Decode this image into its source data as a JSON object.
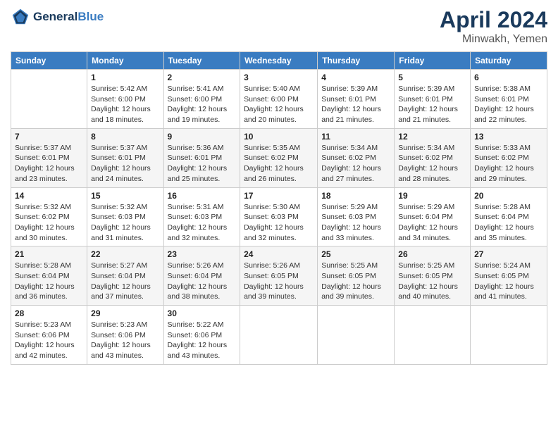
{
  "header": {
    "logo_line1": "General",
    "logo_line2": "Blue",
    "month_title": "April 2024",
    "location": "Minwakh, Yemen"
  },
  "weekdays": [
    "Sunday",
    "Monday",
    "Tuesday",
    "Wednesday",
    "Thursday",
    "Friday",
    "Saturday"
  ],
  "weeks": [
    [
      {
        "day": "",
        "info": ""
      },
      {
        "day": "1",
        "info": "Sunrise: 5:42 AM\nSunset: 6:00 PM\nDaylight: 12 hours\nand 18 minutes."
      },
      {
        "day": "2",
        "info": "Sunrise: 5:41 AM\nSunset: 6:00 PM\nDaylight: 12 hours\nand 19 minutes."
      },
      {
        "day": "3",
        "info": "Sunrise: 5:40 AM\nSunset: 6:00 PM\nDaylight: 12 hours\nand 20 minutes."
      },
      {
        "day": "4",
        "info": "Sunrise: 5:39 AM\nSunset: 6:01 PM\nDaylight: 12 hours\nand 21 minutes."
      },
      {
        "day": "5",
        "info": "Sunrise: 5:39 AM\nSunset: 6:01 PM\nDaylight: 12 hours\nand 21 minutes."
      },
      {
        "day": "6",
        "info": "Sunrise: 5:38 AM\nSunset: 6:01 PM\nDaylight: 12 hours\nand 22 minutes."
      }
    ],
    [
      {
        "day": "7",
        "info": "Sunrise: 5:37 AM\nSunset: 6:01 PM\nDaylight: 12 hours\nand 23 minutes."
      },
      {
        "day": "8",
        "info": "Sunrise: 5:37 AM\nSunset: 6:01 PM\nDaylight: 12 hours\nand 24 minutes."
      },
      {
        "day": "9",
        "info": "Sunrise: 5:36 AM\nSunset: 6:01 PM\nDaylight: 12 hours\nand 25 minutes."
      },
      {
        "day": "10",
        "info": "Sunrise: 5:35 AM\nSunset: 6:02 PM\nDaylight: 12 hours\nand 26 minutes."
      },
      {
        "day": "11",
        "info": "Sunrise: 5:34 AM\nSunset: 6:02 PM\nDaylight: 12 hours\nand 27 minutes."
      },
      {
        "day": "12",
        "info": "Sunrise: 5:34 AM\nSunset: 6:02 PM\nDaylight: 12 hours\nand 28 minutes."
      },
      {
        "day": "13",
        "info": "Sunrise: 5:33 AM\nSunset: 6:02 PM\nDaylight: 12 hours\nand 29 minutes."
      }
    ],
    [
      {
        "day": "14",
        "info": "Sunrise: 5:32 AM\nSunset: 6:02 PM\nDaylight: 12 hours\nand 30 minutes."
      },
      {
        "day": "15",
        "info": "Sunrise: 5:32 AM\nSunset: 6:03 PM\nDaylight: 12 hours\nand 31 minutes."
      },
      {
        "day": "16",
        "info": "Sunrise: 5:31 AM\nSunset: 6:03 PM\nDaylight: 12 hours\nand 32 minutes."
      },
      {
        "day": "17",
        "info": "Sunrise: 5:30 AM\nSunset: 6:03 PM\nDaylight: 12 hours\nand 32 minutes."
      },
      {
        "day": "18",
        "info": "Sunrise: 5:29 AM\nSunset: 6:03 PM\nDaylight: 12 hours\nand 33 minutes."
      },
      {
        "day": "19",
        "info": "Sunrise: 5:29 AM\nSunset: 6:04 PM\nDaylight: 12 hours\nand 34 minutes."
      },
      {
        "day": "20",
        "info": "Sunrise: 5:28 AM\nSunset: 6:04 PM\nDaylight: 12 hours\nand 35 minutes."
      }
    ],
    [
      {
        "day": "21",
        "info": "Sunrise: 5:28 AM\nSunset: 6:04 PM\nDaylight: 12 hours\nand 36 minutes."
      },
      {
        "day": "22",
        "info": "Sunrise: 5:27 AM\nSunset: 6:04 PM\nDaylight: 12 hours\nand 37 minutes."
      },
      {
        "day": "23",
        "info": "Sunrise: 5:26 AM\nSunset: 6:04 PM\nDaylight: 12 hours\nand 38 minutes."
      },
      {
        "day": "24",
        "info": "Sunrise: 5:26 AM\nSunset: 6:05 PM\nDaylight: 12 hours\nand 39 minutes."
      },
      {
        "day": "25",
        "info": "Sunrise: 5:25 AM\nSunset: 6:05 PM\nDaylight: 12 hours\nand 39 minutes."
      },
      {
        "day": "26",
        "info": "Sunrise: 5:25 AM\nSunset: 6:05 PM\nDaylight: 12 hours\nand 40 minutes."
      },
      {
        "day": "27",
        "info": "Sunrise: 5:24 AM\nSunset: 6:05 PM\nDaylight: 12 hours\nand 41 minutes."
      }
    ],
    [
      {
        "day": "28",
        "info": "Sunrise: 5:23 AM\nSunset: 6:06 PM\nDaylight: 12 hours\nand 42 minutes."
      },
      {
        "day": "29",
        "info": "Sunrise: 5:23 AM\nSunset: 6:06 PM\nDaylight: 12 hours\nand 43 minutes."
      },
      {
        "day": "30",
        "info": "Sunrise: 5:22 AM\nSunset: 6:06 PM\nDaylight: 12 hours\nand 43 minutes."
      },
      {
        "day": "",
        "info": ""
      },
      {
        "day": "",
        "info": ""
      },
      {
        "day": "",
        "info": ""
      },
      {
        "day": "",
        "info": ""
      }
    ]
  ]
}
